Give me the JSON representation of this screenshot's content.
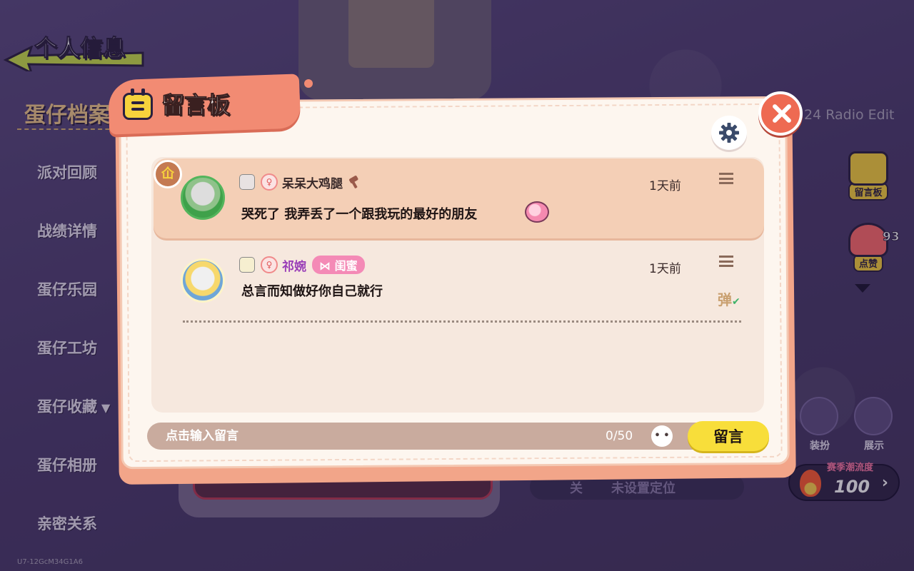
{
  "page": {
    "back_title": "个人信息",
    "section_title": "蛋仔档案",
    "side_menu": [
      {
        "label": "派对回顾"
      },
      {
        "label": "战绩详情"
      },
      {
        "label": "蛋仔乐园"
      },
      {
        "label": "蛋仔工坊"
      },
      {
        "label": "蛋仔收藏"
      },
      {
        "label": "蛋仔相册"
      },
      {
        "label": "亲密关系"
      }
    ],
    "version_text": "U7-12GcM34G1A6",
    "radio_text": "24 Radio Edit",
    "right_buttons": {
      "board_label": "留言板",
      "like_label": "点赞",
      "like_count": "93",
      "dress_label": "装扮",
      "show_label": "展示"
    },
    "popularity": {
      "label": "赛季潮流度",
      "value": "100"
    },
    "location": {
      "part1": "关",
      "part2": "未设置定位"
    }
  },
  "dialog": {
    "title": "留言板",
    "messages": [
      {
        "username": "呆呆大鸡腿",
        "time": "1天前",
        "content": "哭死了 我弄丢了一个跟我玩的最好的朋友",
        "badge": "仚"
      },
      {
        "username": "祁婉",
        "tag": "闺蜜",
        "time": "1天前",
        "content": "总言而知做好你自己就行",
        "danmu": "弹"
      }
    ],
    "input": {
      "placeholder": "点击输入留言",
      "counter": "0/50",
      "send_label": "留言"
    }
  },
  "colors": {
    "accent": "#f28b73",
    "send_button": "#f8de3a",
    "tag_pink": "#f48ab6",
    "background": "#4a3a6e"
  },
  "icons": {
    "close": "close-icon",
    "settings": "gear-icon",
    "board": "calendar-icon",
    "like": "thumbs-up-icon",
    "emoji": "emoji-icon"
  }
}
